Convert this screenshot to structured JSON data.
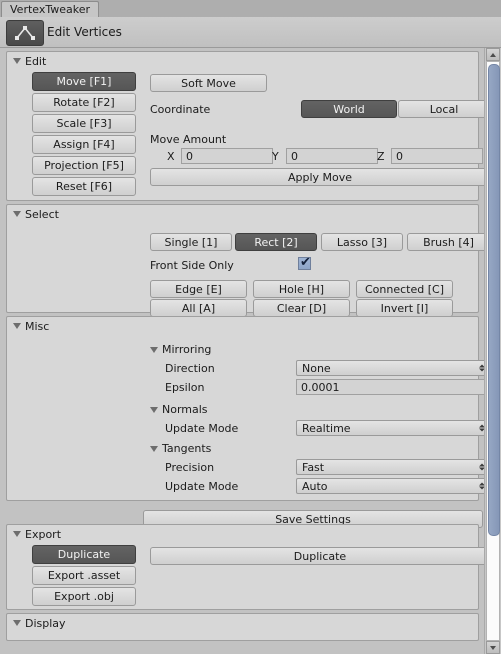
{
  "window": {
    "tab_title": "VertexTweaker",
    "header_title": "Edit Vertices",
    "header_icon": "vertices-icon"
  },
  "edit": {
    "title": "Edit",
    "tools": [
      {
        "label": "Move [F1]",
        "selected": true
      },
      {
        "label": "Rotate [F2]",
        "selected": false
      },
      {
        "label": "Scale [F3]",
        "selected": false
      },
      {
        "label": "Assign [F4]",
        "selected": false
      },
      {
        "label": "Projection [F5]",
        "selected": false
      },
      {
        "label": "Reset [F6]",
        "selected": false
      }
    ],
    "soft_move_label": "Soft Move",
    "coordinate_label": "Coordinate",
    "coordinate_options": [
      {
        "label": "World",
        "selected": true
      },
      {
        "label": "Local",
        "selected": false
      }
    ],
    "move_amount_label": "Move Amount",
    "axes": [
      {
        "axis": "X",
        "value": "0"
      },
      {
        "axis": "Y",
        "value": "0"
      },
      {
        "axis": "Z",
        "value": "0"
      }
    ],
    "apply_move_label": "Apply Move"
  },
  "select": {
    "title": "Select",
    "modes": [
      {
        "label": "Single [1]",
        "selected": false
      },
      {
        "label": "Rect [2]",
        "selected": true
      },
      {
        "label": "Lasso [3]",
        "selected": false
      },
      {
        "label": "Brush [4]",
        "selected": false
      }
    ],
    "front_side_only_label": "Front Side Only",
    "front_side_only_checked": true,
    "checkmark": "✔",
    "actions_row1": [
      "Edge [E]",
      "Hole [H]",
      "Connected [C]"
    ],
    "actions_row2": [
      "All [A]",
      "Clear [D]",
      "Invert [I]"
    ]
  },
  "misc": {
    "title": "Misc",
    "mirroring": {
      "title": "Mirroring",
      "direction_label": "Direction",
      "direction_value": "None",
      "epsilon_label": "Epsilon",
      "epsilon_value": "0.0001"
    },
    "normals": {
      "title": "Normals",
      "update_mode_label": "Update Mode",
      "update_mode_value": "Realtime"
    },
    "tangents": {
      "title": "Tangents",
      "precision_label": "Precision",
      "precision_value": "Fast",
      "update_mode_label": "Update Mode",
      "update_mode_value": "Auto"
    },
    "save_settings_label": "Save Settings"
  },
  "export": {
    "title": "Export",
    "modes": [
      {
        "label": "Duplicate",
        "selected": true
      },
      {
        "label": "Export .asset",
        "selected": false
      },
      {
        "label": "Export .obj",
        "selected": false
      }
    ],
    "action_label": "Duplicate"
  },
  "display": {
    "title": "Display"
  }
}
